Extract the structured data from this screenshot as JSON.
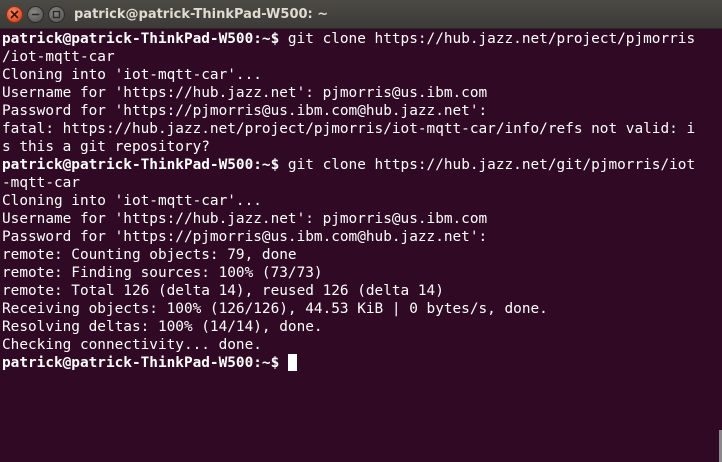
{
  "window": {
    "title": "patrick@patrick-ThinkPad-W500: ~"
  },
  "terminal": {
    "lines": [
      {
        "prompt": "patrick@patrick-ThinkPad-W500:~$",
        "text": " git clone https://hub.jazz.net/project/pjmorris"
      },
      {
        "prompt": "",
        "text": "/iot-mqtt-car"
      },
      {
        "prompt": "",
        "text": "Cloning into 'iot-mqtt-car'..."
      },
      {
        "prompt": "",
        "text": "Username for 'https://hub.jazz.net': pjmorris@us.ibm.com"
      },
      {
        "prompt": "",
        "text": "Password for 'https://pjmorris@us.ibm.com@hub.jazz.net':"
      },
      {
        "prompt": "",
        "text": "fatal: https://hub.jazz.net/project/pjmorris/iot-mqtt-car/info/refs not valid: i"
      },
      {
        "prompt": "",
        "text": "s this a git repository?"
      },
      {
        "prompt": "patrick@patrick-ThinkPad-W500:~$",
        "text": " git clone https://hub.jazz.net/git/pjmorris/iot"
      },
      {
        "prompt": "",
        "text": "-mqtt-car"
      },
      {
        "prompt": "",
        "text": "Cloning into 'iot-mqtt-car'..."
      },
      {
        "prompt": "",
        "text": "Username for 'https://hub.jazz.net': pjmorris@us.ibm.com"
      },
      {
        "prompt": "",
        "text": "Password for 'https://pjmorris@us.ibm.com@hub.jazz.net':"
      },
      {
        "prompt": "",
        "text": "remote: Counting objects: 79, done"
      },
      {
        "prompt": "",
        "text": "remote: Finding sources: 100% (73/73)"
      },
      {
        "prompt": "",
        "text": "remote: Total 126 (delta 14), reused 126 (delta 14)"
      },
      {
        "prompt": "",
        "text": "Receiving objects: 100% (126/126), 44.53 KiB | 0 bytes/s, done."
      },
      {
        "prompt": "",
        "text": "Resolving deltas: 100% (14/14), done."
      },
      {
        "prompt": "",
        "text": "Checking connectivity... done."
      },
      {
        "prompt": "patrick@patrick-ThinkPad-W500:~$",
        "text": " "
      }
    ],
    "cursor_line": 18
  },
  "colors": {
    "background": "#300a24",
    "text": "#ffffff",
    "close_button": "#e0532c",
    "titlebar": "#3c3b37"
  },
  "icons": {
    "close": "close-icon",
    "minimize": "minimize-icon",
    "maximize": "maximize-icon"
  }
}
